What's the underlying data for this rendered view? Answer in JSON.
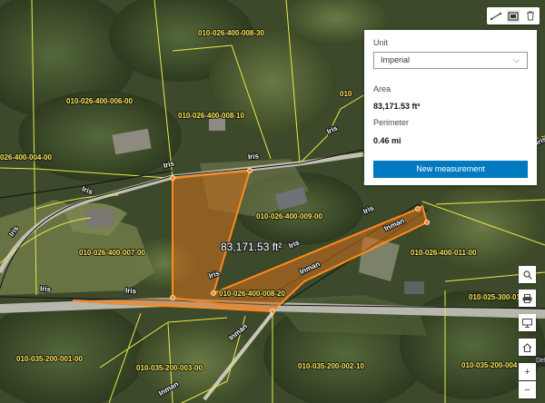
{
  "map": {
    "parcels": [
      "010-026-400-008-30",
      "010-026-400-006-00",
      "010-026-400-008-10",
      "026-400-004-00",
      "010-026-400-009-00",
      "010-026-400-007-00",
      "010-026-400-011-00",
      "010-026-400-008-20",
      "010-035-200-001-00",
      "010-035-200-003-00",
      "010-035-200-002-10",
      "010-025-300-01",
      "010-035-200-004",
      "010"
    ],
    "roads": [
      "Iris",
      "Iris",
      "Iris",
      "Iris",
      "Iris",
      "Iris",
      "Iris",
      "Inman",
      "Inman",
      "Inman",
      "Inman"
    ],
    "measured_area": "83,171.53 ft²",
    "colors": {
      "parcel_line": "#e8e84a",
      "measure_line": "#ff8a1c",
      "measure_fill": "#d1701c",
      "road_line": "#111111"
    }
  },
  "toolbar": {
    "icons": [
      "measure-distance-icon",
      "measure-area-icon",
      "trash-icon"
    ]
  },
  "panel": {
    "unit_label": "Unit",
    "unit_value": "Imperial",
    "area_label": "Area",
    "area_value": "83,171.53 ft²",
    "perimeter_label": "Perimeter",
    "perimeter_value": "0.46 mi",
    "new_measurement_label": "New measurement"
  },
  "widgets": {
    "icons": [
      "search-icon",
      "print-icon",
      "monitor-icon",
      "home-icon",
      "zoom-in-icon",
      "zoom-out-icon"
    ],
    "zoom_in": "+",
    "zoom_out": "−",
    "tooltip": "Defa"
  }
}
